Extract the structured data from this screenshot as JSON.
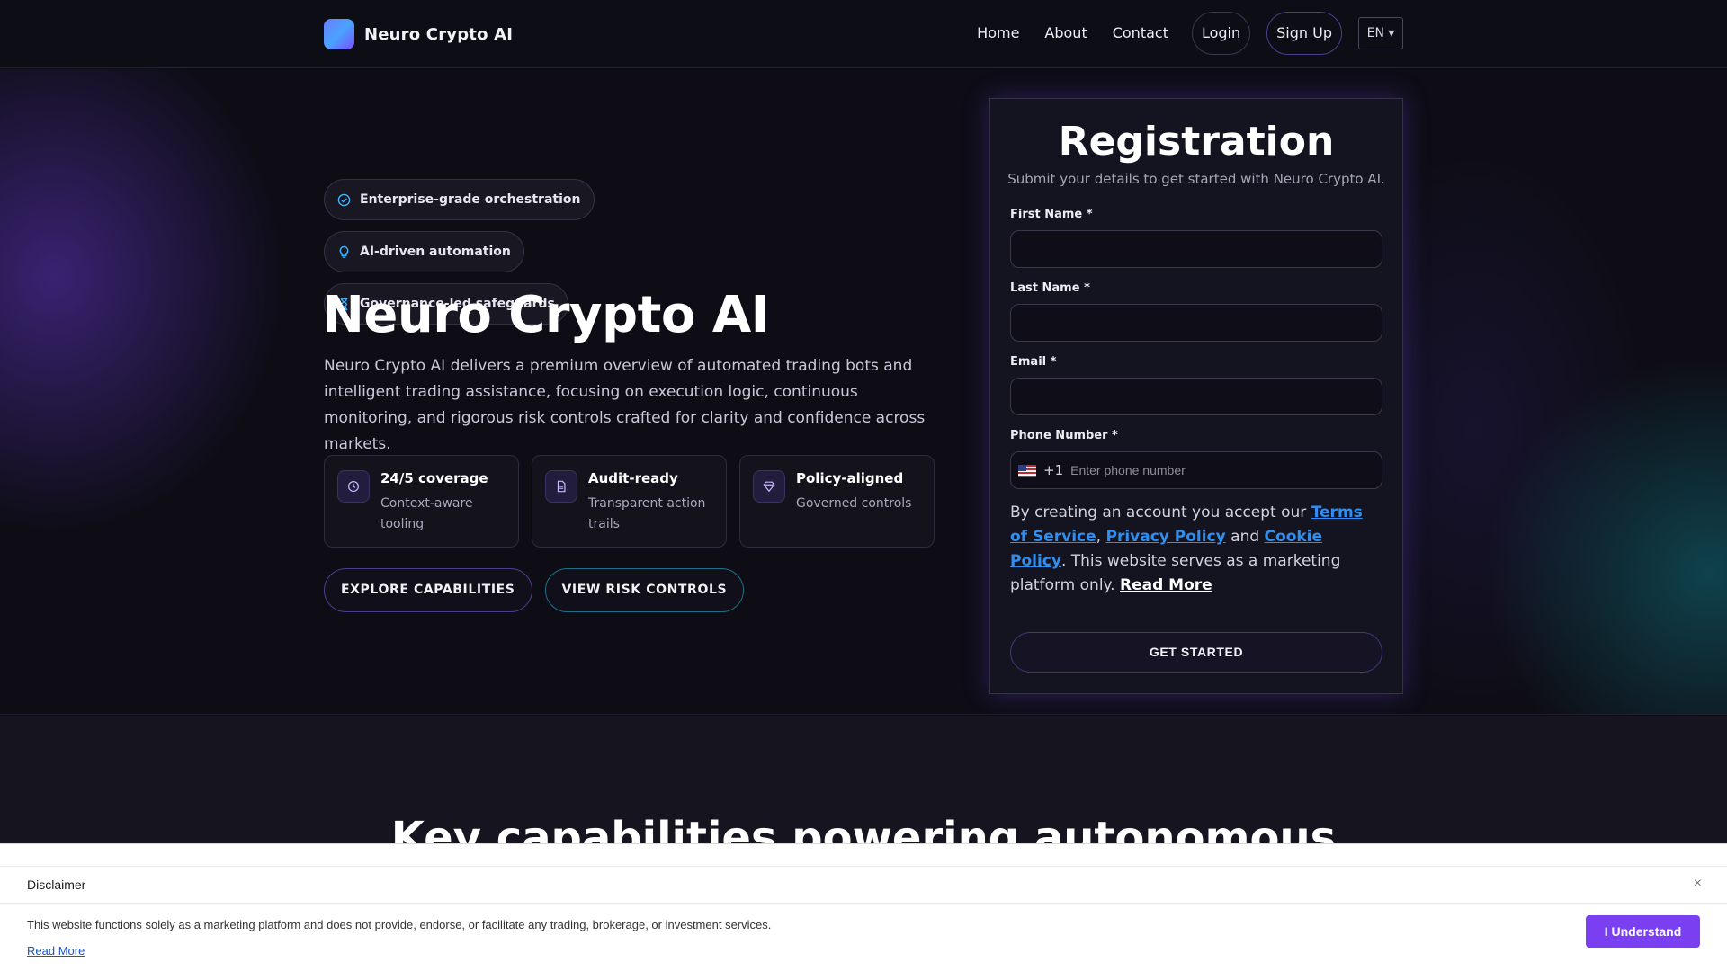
{
  "header": {
    "brand": "Neuro Crypto AI",
    "nav": [
      "Home",
      "About",
      "Contact"
    ],
    "login": "Login",
    "signup": "Sign Up",
    "language": "EN ▾"
  },
  "hero": {
    "chips": [
      {
        "label": "Enterprise-grade orchestration",
        "icon": "check-circle-icon"
      },
      {
        "label": "AI-driven automation",
        "icon": "lightbulb-icon"
      },
      {
        "label": "Governance-led safeguards",
        "icon": "hourglass-icon"
      }
    ],
    "title": "Neuro Crypto AI",
    "description": "Neuro Crypto AI delivers a premium overview of automated trading bots and intelligent trading assistance, focusing on execution logic, continuous monitoring, and rigorous risk controls crafted for clarity and confidence across markets.",
    "stats": [
      {
        "title": "24/5 coverage",
        "subtitle": "Context-aware tooling",
        "icon": "clock-icon"
      },
      {
        "title": "Audit-ready",
        "subtitle": "Transparent action trails",
        "icon": "document-icon"
      },
      {
        "title": "Policy-aligned",
        "subtitle": "Governed controls",
        "icon": "diamond-icon"
      }
    ],
    "buttons": {
      "explore": "EXPLORE CAPABILITIES",
      "risk": "VIEW RISK CONTROLS"
    }
  },
  "registration": {
    "title": "Registration",
    "subtitle": "Submit your details to get started with Neuro Crypto AI.",
    "first_name_label": "First Name *",
    "last_name_label": "Last Name *",
    "email_label": "Email *",
    "phone_label": "Phone Number *",
    "phone_dial_code": "+1",
    "phone_placeholder": "Enter phone number",
    "terms": {
      "prefix": "By creating an account you accept our ",
      "tos": "Terms of Service",
      "comma": ", ",
      "privacy": "Privacy Policy",
      "and": " and ",
      "cookie": "Cookie Policy",
      "suffix": ". This website serves as a marketing platform only. ",
      "read_more": "Read More"
    },
    "submit": "GET STARTED"
  },
  "section2": {
    "title": "Key capabilities powering autonomous"
  },
  "disclaimer": {
    "title": "Disclaimer",
    "close": "×",
    "text": "This website functions solely as a marketing platform and does not provide, endorse, or facilitate any trading, brokerage, or investment services.",
    "read_more": "Read More",
    "accept": "I Understand"
  },
  "colors": {
    "accent_purple": "#7b3ff2",
    "link_blue": "#2f8ff0",
    "teal": "#1f6e86",
    "background": "#0e0d16"
  }
}
